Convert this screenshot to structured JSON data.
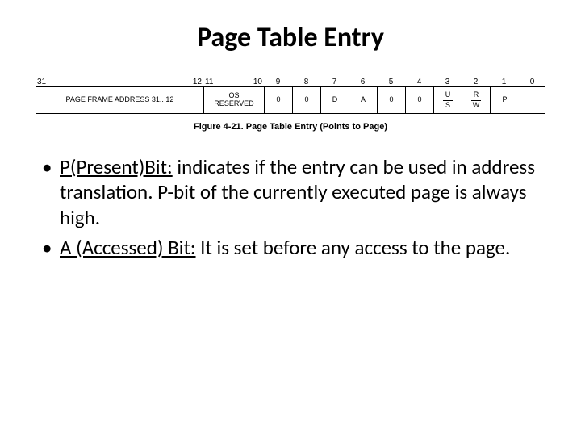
{
  "title": "Page Table Entry",
  "bit_labels": {
    "addr_hi": "31",
    "addr_lo": "12",
    "os_hi": "11",
    "os_lo": "10",
    "b9": "9",
    "b8": "8",
    "b7": "7",
    "b6": "6",
    "b5": "5",
    "b4": "4",
    "b3": "3",
    "b2": "2",
    "b1": "1",
    "b0": "0"
  },
  "fields": {
    "addr": "PAGE FRAME ADDRESS 31.. 12",
    "os_line1": "OS",
    "os_line2": "RESERVED",
    "c9": "0",
    "c8": "0",
    "c7": "D",
    "c6": "A",
    "c5": "0",
    "c4": "0",
    "c3_top": "U",
    "c3_bot": "S",
    "c2_top": "R",
    "c2_bot": "W",
    "c1": "P"
  },
  "caption": "Figure 4-21. Page Table Entry (Points to Page)",
  "bullets": [
    {
      "u": "P(Present)Bit:",
      "rest": " indicates if the entry can be used in address translation. P-bit of the currently executed page is always high."
    },
    {
      "u": "A (Accessed) Bit:",
      "rest": " It is set before any access to the page."
    }
  ]
}
